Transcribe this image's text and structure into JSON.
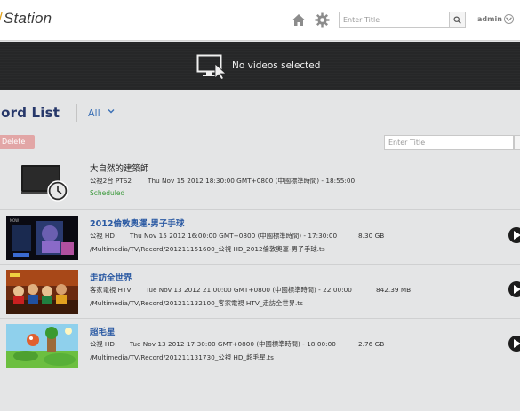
{
  "header": {
    "logo_text": "Station",
    "search_placeholder": "Enter Title",
    "user": "admin"
  },
  "preview": {
    "message": "No videos selected"
  },
  "list": {
    "title": "cord List",
    "filter": "All",
    "delete_label": "Delete",
    "search_placeholder": "Enter Title"
  },
  "rows": [
    {
      "title": "大自然的建築師",
      "channel": "公視2台 PTS2",
      "time": "Thu Nov 15 2012 18:30:00 GMT+0800 (中國標準時間) - 18:55:00",
      "size": "",
      "status": "Scheduled",
      "path": ""
    },
    {
      "title": "2012倫敦奧運-男子手球",
      "channel": "公視 HD",
      "time": "Thu Nov 15 2012 16:00:00 GMT+0800 (中國標準時間) - 17:30:00",
      "size": "8.30 GB",
      "path": "/Multimedia/TV/Record/201211151600_公視 HD_2012倫敦奧運-男子手球.ts"
    },
    {
      "title": "走訪全世界",
      "channel": "客家電視 HTV",
      "time": "Tue Nov 13 2012 21:00:00 GMT+0800 (中國標準時間) - 22:00:00",
      "size": "842.39 MB",
      "path": "/Multimedia/TV/Record/201211132100_客家電視 HTV_走訪全世界.ts"
    },
    {
      "title": "超毛星",
      "channel": "公視 HD",
      "time": "Tue Nov 13 2012 17:30:00 GMT+0800 (中國標準時間) - 18:00:00",
      "size": "2.76 GB",
      "path": "/Multimedia/TV/Record/201211131730_公視 HD_超毛星.ts"
    }
  ],
  "colors": {
    "title_blue": "#27386a",
    "link_blue": "#2b5aa3",
    "scheduled_green": "#3c9a3c",
    "delete_red": "#e2a6a6"
  }
}
